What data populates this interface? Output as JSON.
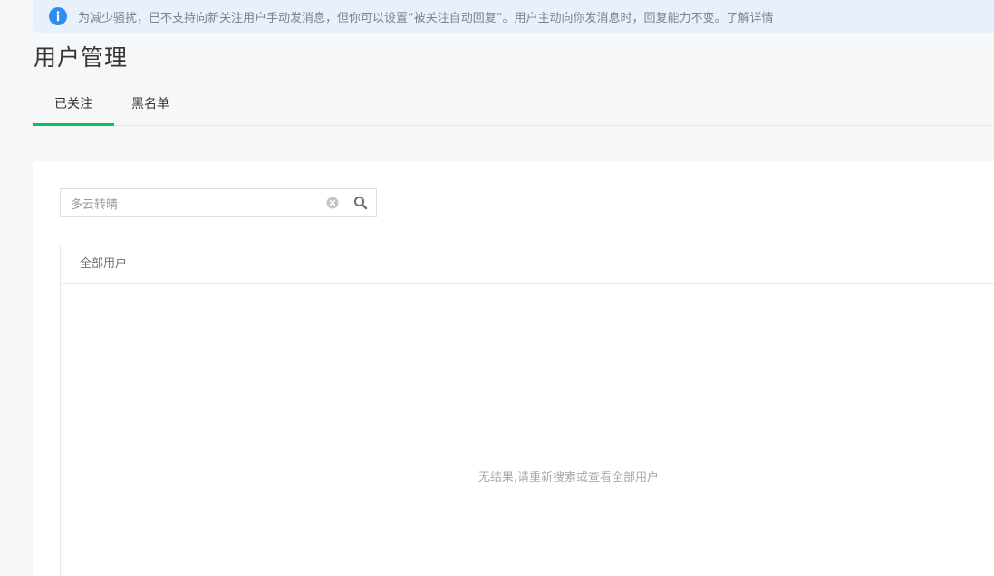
{
  "notice": {
    "icon": "info-icon",
    "text": "为减少骚扰，已不支持向新关注用户手动发消息，但你可以设置“被关注自动回复”。用户主动向你发消息时，回复能力不变。",
    "link": "了解详情",
    "color": "#2d8cf0"
  },
  "page": {
    "title": "用户管理"
  },
  "tabs": [
    {
      "label": "已关注",
      "active": true
    },
    {
      "label": "黑名单",
      "active": false
    }
  ],
  "search": {
    "value": "多云转晴",
    "clear_icon": "clear-circle-icon",
    "search_icon": "search-icon"
  },
  "user_list": {
    "header": "全部用户",
    "empty_text": "无结果,请重新搜索或查看全部用户"
  },
  "colors": {
    "accent": "#07c160",
    "info": "#2d8cf0"
  }
}
